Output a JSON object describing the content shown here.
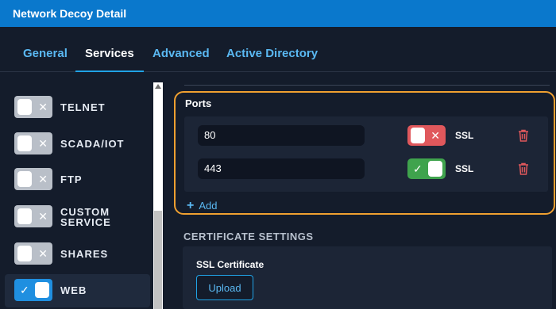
{
  "window": {
    "title": "Network Decoy Detail"
  },
  "tabs": [
    {
      "label": "General",
      "active": false
    },
    {
      "label": "Services",
      "active": true
    },
    {
      "label": "Advanced",
      "active": false
    },
    {
      "label": "Active Directory",
      "active": false
    }
  ],
  "services": [
    {
      "label": "TELNET",
      "enabled": false,
      "mark": "✕"
    },
    {
      "label": "SCADA/IOT",
      "enabled": false,
      "mark": "✕"
    },
    {
      "label": "FTP",
      "enabled": false,
      "mark": "✕"
    },
    {
      "label_line1": "CUSTOM",
      "label_line2": "SERVICE",
      "enabled": false,
      "mark": "✕"
    },
    {
      "label": "SHARES",
      "enabled": false,
      "mark": "✕"
    },
    {
      "label": "WEB",
      "enabled": true,
      "mark": "✓"
    }
  ],
  "ports": {
    "title": "Ports",
    "rows": [
      {
        "port": "80",
        "ssl_label": "SSL",
        "ssl_enabled": false,
        "ssl_mark": "✕"
      },
      {
        "port": "443",
        "ssl_label": "SSL",
        "ssl_enabled": true,
        "ssl_mark": "✓"
      }
    ],
    "add_label": "Add",
    "add_icon": "+"
  },
  "certificate": {
    "section_title": "CERTIFICATE SETTINGS",
    "label": "SSL Certificate",
    "upload_label": "Upload"
  },
  "colors": {
    "accent": "#20a3e6",
    "titlebar": "#0a78cc",
    "highlight_border": "#f0a030",
    "ssl_off": "#e0585c",
    "ssl_on": "#3fa34d",
    "delete": "#e0585c"
  }
}
